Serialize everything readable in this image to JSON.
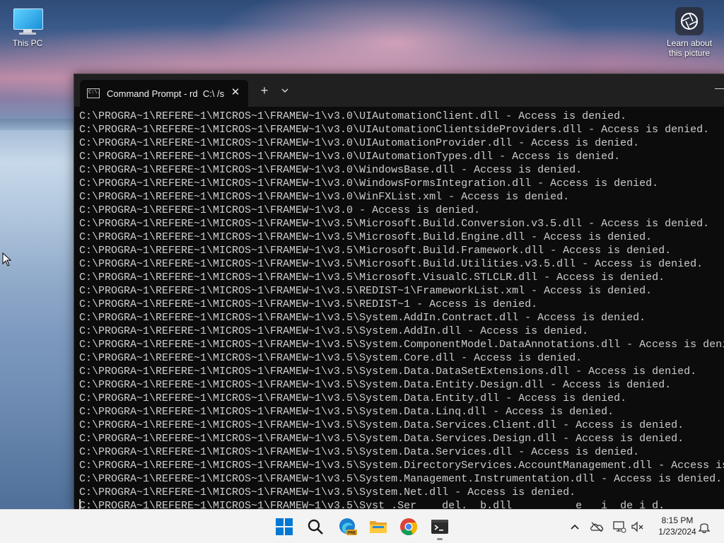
{
  "desktop": {
    "icons": [
      {
        "label": "This PC"
      },
      {
        "label": "Learn about this picture"
      }
    ]
  },
  "terminal": {
    "tab_title": "Command Prompt - rd  C:\\ /s",
    "tab_icon_text": "C:\\.",
    "close_tab": "✕",
    "new_tab": "+",
    "dropdown": "⌄",
    "lines": [
      "C:\\PROGRA~1\\REFERE~1\\MICROS~1\\FRAMEW~1\\v3.0\\UIAutomationClient.dll - Access is denied.",
      "C:\\PROGRA~1\\REFERE~1\\MICROS~1\\FRAMEW~1\\v3.0\\UIAutomationClientsideProviders.dll - Access is denied.",
      "C:\\PROGRA~1\\REFERE~1\\MICROS~1\\FRAMEW~1\\v3.0\\UIAutomationProvider.dll - Access is denied.",
      "C:\\PROGRA~1\\REFERE~1\\MICROS~1\\FRAMEW~1\\v3.0\\UIAutomationTypes.dll - Access is denied.",
      "C:\\PROGRA~1\\REFERE~1\\MICROS~1\\FRAMEW~1\\v3.0\\WindowsBase.dll - Access is denied.",
      "C:\\PROGRA~1\\REFERE~1\\MICROS~1\\FRAMEW~1\\v3.0\\WindowsFormsIntegration.dll - Access is denied.",
      "C:\\PROGRA~1\\REFERE~1\\MICROS~1\\FRAMEW~1\\v3.0\\WinFXList.xml - Access is denied.",
      "C:\\PROGRA~1\\REFERE~1\\MICROS~1\\FRAMEW~1\\v3.0 - Access is denied.",
      "C:\\PROGRA~1\\REFERE~1\\MICROS~1\\FRAMEW~1\\v3.5\\Microsoft.Build.Conversion.v3.5.dll - Access is denied.",
      "C:\\PROGRA~1\\REFERE~1\\MICROS~1\\FRAMEW~1\\v3.5\\Microsoft.Build.Engine.dll - Access is denied.",
      "C:\\PROGRA~1\\REFERE~1\\MICROS~1\\FRAMEW~1\\v3.5\\Microsoft.Build.Framework.dll - Access is denied.",
      "C:\\PROGRA~1\\REFERE~1\\MICROS~1\\FRAMEW~1\\v3.5\\Microsoft.Build.Utilities.v3.5.dll - Access is denied.",
      "C:\\PROGRA~1\\REFERE~1\\MICROS~1\\FRAMEW~1\\v3.5\\Microsoft.VisualC.STLCLR.dll - Access is denied.",
      "C:\\PROGRA~1\\REFERE~1\\MICROS~1\\FRAMEW~1\\v3.5\\REDIST~1\\FrameworkList.xml - Access is denied.",
      "C:\\PROGRA~1\\REFERE~1\\MICROS~1\\FRAMEW~1\\v3.5\\REDIST~1 - Access is denied.",
      "C:\\PROGRA~1\\REFERE~1\\MICROS~1\\FRAMEW~1\\v3.5\\System.AddIn.Contract.dll - Access is denied.",
      "C:\\PROGRA~1\\REFERE~1\\MICROS~1\\FRAMEW~1\\v3.5\\System.AddIn.dll - Access is denied.",
      "C:\\PROGRA~1\\REFERE~1\\MICROS~1\\FRAMEW~1\\v3.5\\System.ComponentModel.DataAnnotations.dll - Access is deni",
      "C:\\PROGRA~1\\REFERE~1\\MICROS~1\\FRAMEW~1\\v3.5\\System.Core.dll - Access is denied.",
      "C:\\PROGRA~1\\REFERE~1\\MICROS~1\\FRAMEW~1\\v3.5\\System.Data.DataSetExtensions.dll - Access is denied.",
      "C:\\PROGRA~1\\REFERE~1\\MICROS~1\\FRAMEW~1\\v3.5\\System.Data.Entity.Design.dll - Access is denied.",
      "C:\\PROGRA~1\\REFERE~1\\MICROS~1\\FRAMEW~1\\v3.5\\System.Data.Entity.dll - Access is denied.",
      "C:\\PROGRA~1\\REFERE~1\\MICROS~1\\FRAMEW~1\\v3.5\\System.Data.Linq.dll - Access is denied.",
      "C:\\PROGRA~1\\REFERE~1\\MICROS~1\\FRAMEW~1\\v3.5\\System.Data.Services.Client.dll - Access is denied.",
      "C:\\PROGRA~1\\REFERE~1\\MICROS~1\\FRAMEW~1\\v3.5\\System.Data.Services.Design.dll - Access is denied.",
      "C:\\PROGRA~1\\REFERE~1\\MICROS~1\\FRAMEW~1\\v3.5\\System.Data.Services.dll - Access is denied.",
      "C:\\PROGRA~1\\REFERE~1\\MICROS~1\\FRAMEW~1\\v3.5\\System.DirectoryServices.AccountManagement.dll - Access is",
      "C:\\PROGRA~1\\REFERE~1\\MICROS~1\\FRAMEW~1\\v3.5\\System.Management.Instrumentation.dll - Access is denied.",
      "C:\\PROGRA~1\\REFERE~1\\MICROS~1\\FRAMEW~1\\v3.5\\System.Net.dll - Access is denied.",
      "C:\\PROGRA~1\\REFERE~1\\MICROS~1\\FRAMEW~1\\v3.5\\Syst .Ser    del.  b.dll          e   i  de i d."
    ]
  },
  "taskbar": {
    "apps": [
      {
        "icon": "windows-start-icon"
      },
      {
        "icon": "search-icon"
      },
      {
        "icon": "edge-beta-icon",
        "badge": "PRE"
      },
      {
        "icon": "file-explorer-icon"
      },
      {
        "icon": "chrome-icon"
      },
      {
        "icon": "terminal-icon"
      }
    ],
    "tray": {
      "icons": [
        "chevron-up-icon",
        "onedrive-icon",
        "network-icon",
        "volume-muted-icon",
        "notification-bell-icon"
      ],
      "time": "8:15 PM",
      "date": "1/23/2024"
    }
  },
  "colors": {
    "console_bg": "#0c0c0c",
    "console_text": "#cccccc",
    "titlebar": "#202020",
    "taskbar": "#f3f3f3",
    "start_blue": "#0078d4"
  }
}
